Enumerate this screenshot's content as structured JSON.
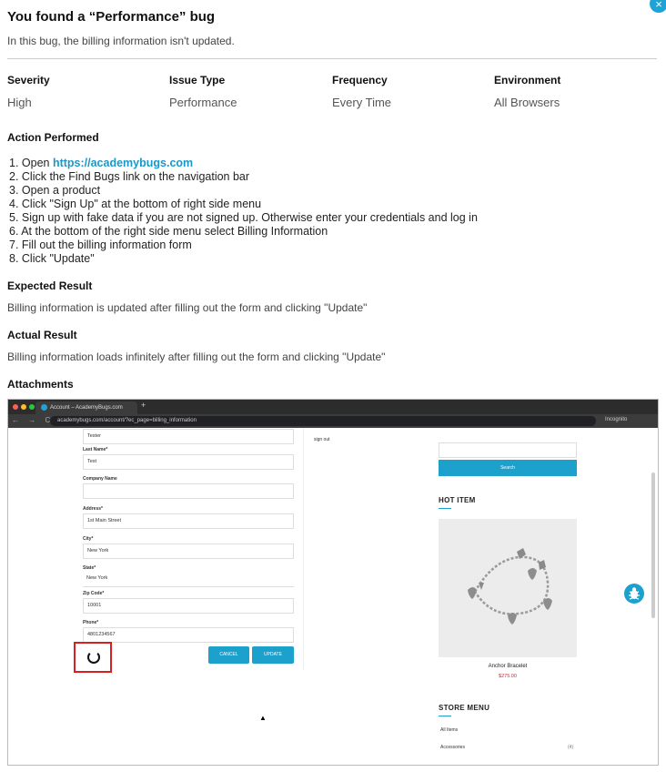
{
  "header": {
    "title": "You found a “Performance” bug",
    "subtitle": "In this bug, the billing information isn't updated.",
    "close_glyph": "×"
  },
  "meta": [
    {
      "label": "Severity",
      "value": "High"
    },
    {
      "label": "Issue Type",
      "value": "Performance"
    },
    {
      "label": "Frequency",
      "value": "Every Time"
    },
    {
      "label": "Environment",
      "value": "All Browsers"
    }
  ],
  "action": {
    "heading": "Action Performed",
    "step1_prefix": "1. Open ",
    "step1_link": "https://academybugs.com",
    "steps": [
      "2. Click the Find Bugs link on the navigation bar",
      "3. Open a product",
      "4. Click \"Sign Up\" at the bottom of right side menu",
      "5. Sign up with fake data if you are not signed up. Otherwise enter your credentials and log in",
      "6. At the bottom of the right side menu select Billing Information",
      "7. Fill out the billing information form",
      "8. Click \"Update\""
    ]
  },
  "expected": {
    "heading": "Expected Result",
    "text": "Billing information is updated after filling out the form and clicking \"Update\""
  },
  "actual": {
    "heading": "Actual Result",
    "text": "Billing information loads infinitely after filling out the form and clicking \"Update\""
  },
  "attachments": {
    "heading": "Attachments",
    "browser": {
      "tab_title": "Account – AcademyBugs.com",
      "new_tab": "+",
      "nav_glyphs": "← → C",
      "url": "academybugs.com/account/?ec_page=billing_information",
      "profile": "Incognito"
    },
    "form": {
      "first_value": "Tester",
      "fields": [
        {
          "label": "Last Name*",
          "value": "Test"
        },
        {
          "label": "Company Name",
          "value": ""
        },
        {
          "label": "Address*",
          "value": "1st Main Street"
        },
        {
          "label": "City*",
          "value": "New York"
        },
        {
          "label": "State*",
          "value": "New York"
        },
        {
          "label": "Zip Code*",
          "value": "10001"
        },
        {
          "label": "Phone*",
          "value": "4801234567"
        }
      ],
      "cancel": "CANCEL",
      "update": "UPDATE"
    },
    "account_menu": {
      "sign_out": "sign out"
    },
    "sidebar": {
      "search_button": "Search",
      "hot_item_heading": "HOT ITEM",
      "product_name": "Anchor Bracelet",
      "product_price": "$275.00",
      "store_menu_heading": "STORE MENU",
      "menu_items": [
        {
          "label": "All Items",
          "count": ""
        },
        {
          "label": "Accessories",
          "count": "(4)"
        }
      ]
    }
  },
  "colors": {
    "accent": "#1ca0cc",
    "highlight": "#d92020"
  }
}
